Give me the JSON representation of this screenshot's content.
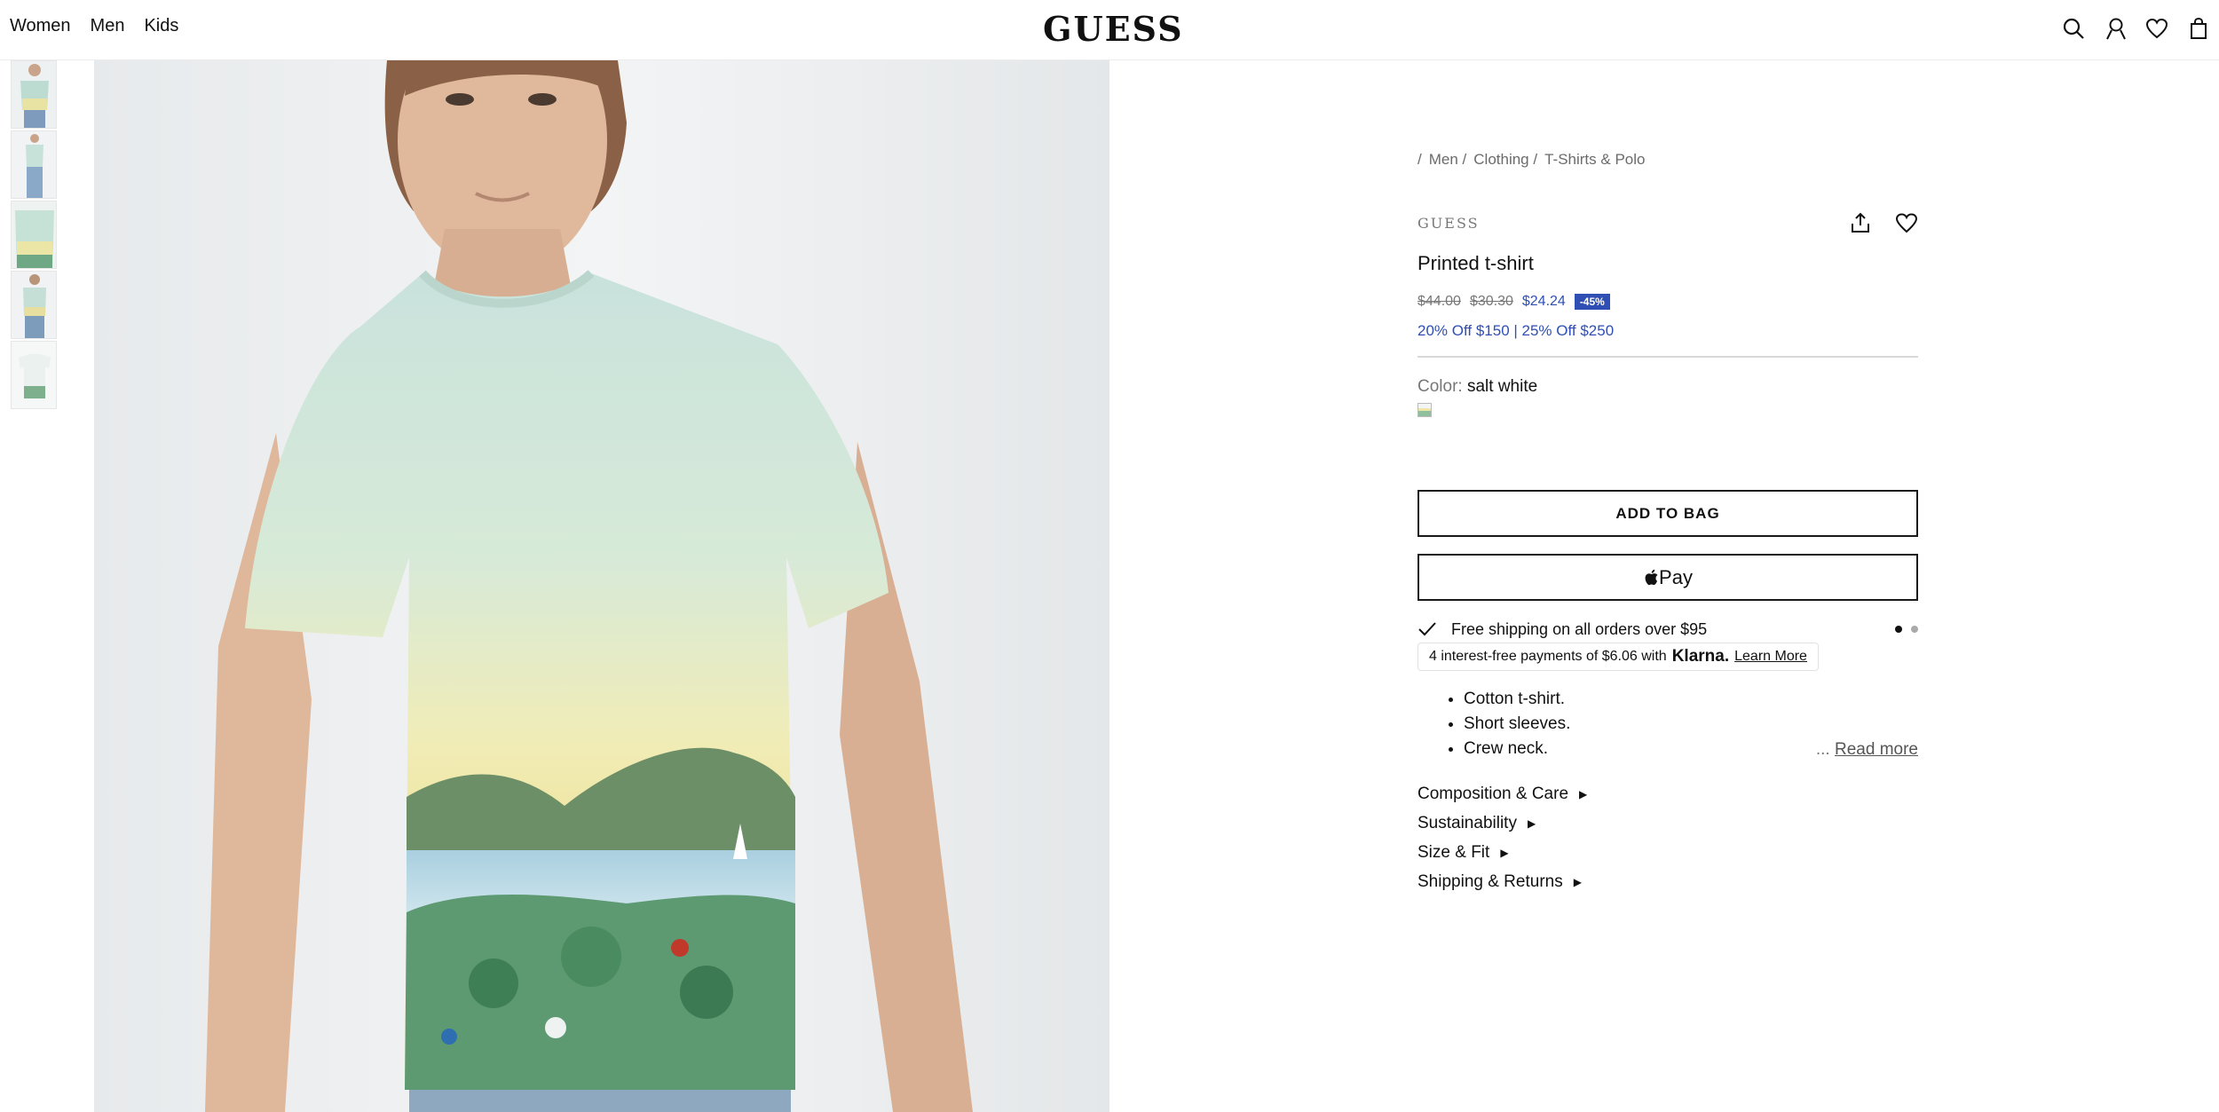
{
  "header": {
    "nav": [
      "Women",
      "Men",
      "Kids"
    ],
    "logo": "GUESS"
  },
  "icons": [
    "search-icon",
    "account-icon",
    "wishlist-icon",
    "bag-icon"
  ],
  "breadcrumb": [
    "/",
    "Men /",
    "Clothing /",
    "T-Shirts & Polo"
  ],
  "product": {
    "brand": "GUESS",
    "title": "Printed t-shirt",
    "price_original": "$44.00",
    "price_previous": "$30.30",
    "price_sale": "$24.24",
    "discount_badge": "-45%",
    "promo": "20% Off $150 | 25% Off $250",
    "color_label": "Color:",
    "color_value": "salt white",
    "add_to_bag": "ADD TO BAG",
    "apple_pay": "Pay",
    "shipping": "Free shipping on all orders over $95",
    "klarna_pre": "4 interest-free payments of $6.06 with",
    "klarna_brand": "Klarna.",
    "klarna_link": "Learn More",
    "features": [
      "Cotton t-shirt.",
      "Short sleeves.",
      "Crew neck."
    ],
    "read_more_ellipsis": "...",
    "read_more": "Read more",
    "accordions": [
      "Composition & Care",
      "Sustainability",
      "Size & Fit",
      "Shipping & Returns"
    ]
  },
  "colors": {
    "accent": "#2f4fb4",
    "text": "#111111",
    "muted": "#777777"
  }
}
